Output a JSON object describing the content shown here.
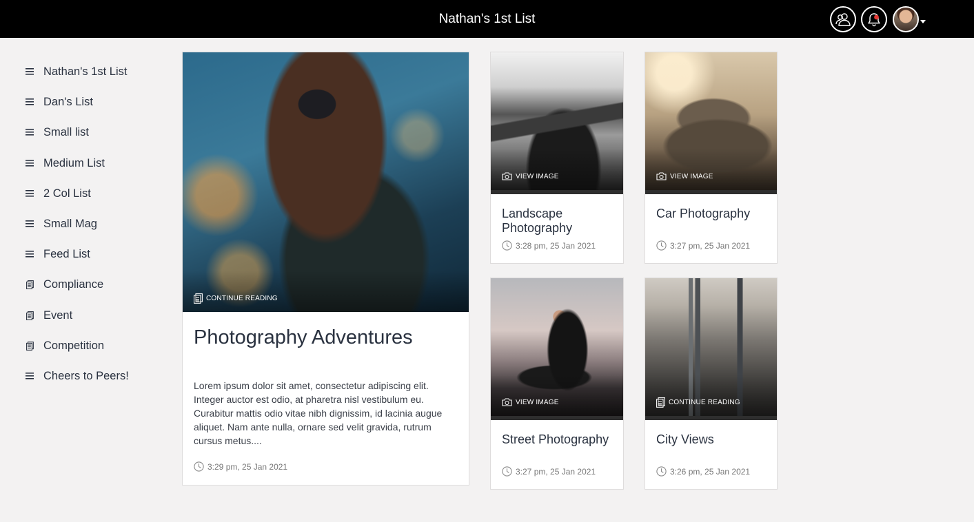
{
  "header": {
    "title": "Nathan's 1st List",
    "icons": [
      "users-icon",
      "bell-icon",
      "avatar"
    ],
    "notification_dot_color": "#e53935"
  },
  "sidebar": {
    "items": [
      {
        "label": "Nathan's 1st List",
        "icon": "list-icon"
      },
      {
        "label": "Dan's List",
        "icon": "list-icon"
      },
      {
        "label": "Small list",
        "icon": "list-icon"
      },
      {
        "label": "Medium List",
        "icon": "list-icon"
      },
      {
        "label": "2 Col List",
        "icon": "list-icon"
      },
      {
        "label": "Small Mag",
        "icon": "list-icon"
      },
      {
        "label": "Feed List",
        "icon": "list-icon"
      },
      {
        "label": "Compliance",
        "icon": "document-icon"
      },
      {
        "label": "Event",
        "icon": "document-icon"
      },
      {
        "label": "Competition",
        "icon": "document-icon"
      },
      {
        "label": "Cheers to Peers!",
        "icon": "list-icon"
      }
    ]
  },
  "cards": [
    {
      "title": "Photography Adventures",
      "overlay": "CONTINUE READING",
      "overlay_icon": "document-icon",
      "excerpt": "Lorem ipsum dolor sit amet, consectetur adipiscing elit. Integer auctor est odio, at pharetra nisl vestibulum eu. Curabitur mattis odio vitae nibh dignissim, id lacinia augue aliquet. Nam ante nulla, ornare sed velit gravida, rutrum cursus metus....",
      "timestamp": "3:29 pm, 25 Jan 2021"
    },
    {
      "title": "Landscape Photography",
      "overlay": "VIEW IMAGE",
      "overlay_icon": "camera-icon",
      "timestamp": "3:28 pm, 25 Jan 2021"
    },
    {
      "title": "Car Photography",
      "overlay": "VIEW IMAGE",
      "overlay_icon": "camera-icon",
      "timestamp": "3:27 pm, 25 Jan 2021"
    },
    {
      "title": "Street Photography",
      "overlay": "VIEW IMAGE",
      "overlay_icon": "camera-icon",
      "timestamp": "3:27 pm, 25 Jan 2021"
    },
    {
      "title": "City Views",
      "overlay": "CONTINUE READING",
      "overlay_icon": "document-icon",
      "timestamp": "3:26 pm, 25 Jan 2021"
    }
  ]
}
